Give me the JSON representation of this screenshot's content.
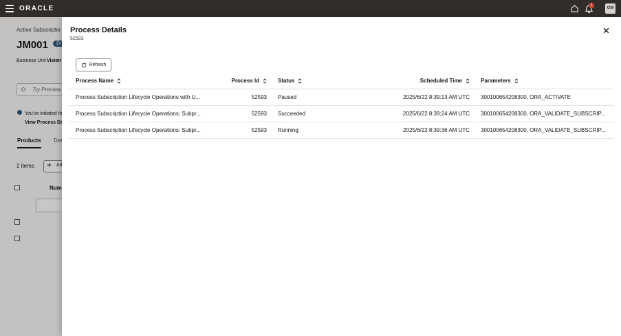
{
  "topbar": {
    "logo": "ORACLE",
    "notification_count": "1",
    "user_initials": "OM"
  },
  "background_page": {
    "breadcrumb": "Active Subscriptio",
    "title": "JM001",
    "badge": "Dr",
    "business_unit_label": "Business Unit",
    "business_unit_value": "Vision",
    "search_placeholder": "Try Preview",
    "info_text": "You've initiated th",
    "info_link": "View Process Det",
    "tabs": [
      "Products",
      "Det"
    ],
    "items_count": "2 items",
    "add_label": "Ad",
    "column_num": "Num"
  },
  "drawer": {
    "title": "Process Details",
    "subtitle": "52593",
    "refresh_label": "Refresh",
    "columns": {
      "name": "Process Name",
      "pid": "Process Id",
      "status": "Status",
      "time": "Scheduled Time",
      "params": "Parameters"
    },
    "rows": [
      {
        "name": "Process Subscription Lifecycle Operations with U...",
        "pid": "52593",
        "status": "Paused",
        "time": "2025/6/22 8:39:13 AM UTC",
        "params": "300100654208300, ORA_ACTIVATE"
      },
      {
        "name": "Process Subscription Lifecycle Operations: Subpr...",
        "pid": "52593",
        "status": "Succeeded",
        "time": "2025/6/22 8:39:24 AM UTC",
        "params": "300100654208300, ORA_VALIDATE_SUBSCRIP..."
      },
      {
        "name": "Process Subscription Lifecycle Operations: Subpr...",
        "pid": "52593",
        "status": "Running",
        "time": "2025/6/22 8:39:36 AM UTC",
        "params": "300100654208300, ORA_VALIDATE_SUBSCRIP..."
      }
    ]
  }
}
